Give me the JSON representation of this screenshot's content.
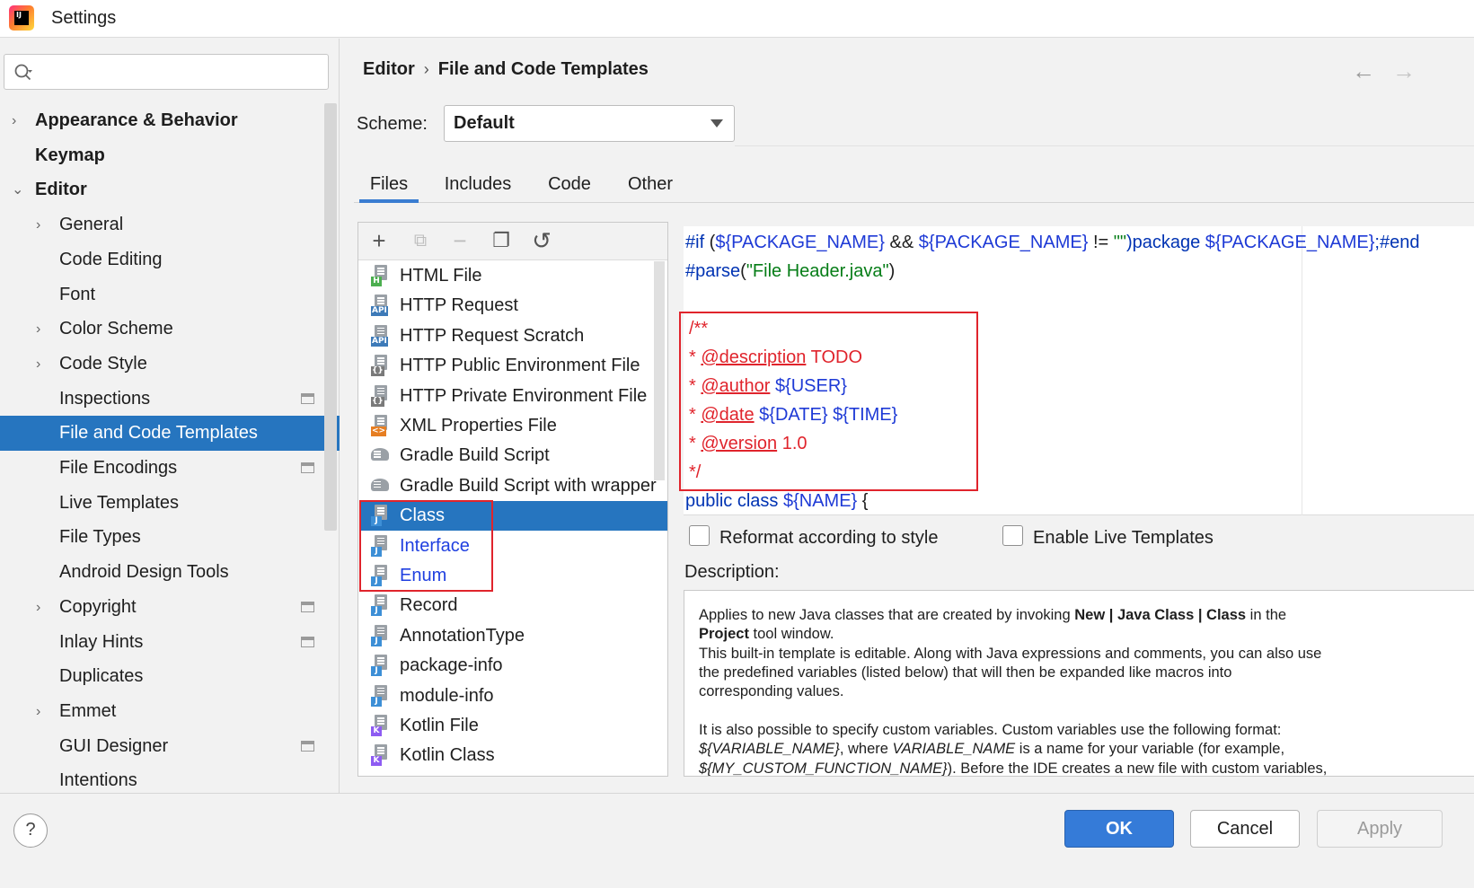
{
  "window": {
    "title": "Settings",
    "logo_text": "IJ"
  },
  "search": {
    "placeholder": ""
  },
  "sidebar": {
    "items": [
      {
        "label": "Appearance & Behavior",
        "arrow": "›",
        "bold": true
      },
      {
        "label": "Keymap",
        "arrow": "",
        "bold": true
      },
      {
        "label": "Editor",
        "arrow": "⌄",
        "bold": true
      },
      {
        "label": "General",
        "arrow": "›"
      },
      {
        "label": "Code Editing",
        "arrow": ""
      },
      {
        "label": "Font",
        "arrow": ""
      },
      {
        "label": "Color Scheme",
        "arrow": "›"
      },
      {
        "label": "Code Style",
        "arrow": "›"
      },
      {
        "label": "Inspections",
        "arrow": "",
        "project_icon": "project-settings-icon"
      },
      {
        "label": "File and Code Templates",
        "arrow": "",
        "selected": true
      },
      {
        "label": "File Encodings",
        "arrow": "",
        "project_icon": "project-settings-icon"
      },
      {
        "label": "Live Templates",
        "arrow": ""
      },
      {
        "label": "File Types",
        "arrow": ""
      },
      {
        "label": "Android Design Tools",
        "arrow": ""
      },
      {
        "label": "Copyright",
        "arrow": "›",
        "project_icon": "project-settings-icon"
      },
      {
        "label": "Inlay Hints",
        "arrow": "",
        "project_icon": "project-settings-icon"
      },
      {
        "label": "Duplicates",
        "arrow": ""
      },
      {
        "label": "Emmet",
        "arrow": "›"
      },
      {
        "label": "GUI Designer",
        "arrow": "",
        "project_icon": "project-settings-icon"
      },
      {
        "label": "Intentions",
        "arrow": ""
      }
    ]
  },
  "breadcrumb": {
    "parent": "Editor",
    "separator": "›",
    "current": "File and Code Templates"
  },
  "nav": {
    "back": "←",
    "forward": "→"
  },
  "scheme": {
    "label": "Scheme:",
    "value": "Default"
  },
  "tabs": [
    {
      "label": "Files",
      "active": true
    },
    {
      "label": "Includes"
    },
    {
      "label": "Code"
    },
    {
      "label": "Other"
    }
  ],
  "toolbar": {
    "add": "+",
    "copy_add": "⧉",
    "remove": "−",
    "duplicate": "❐",
    "reset": "↺"
  },
  "templates": [
    {
      "label": "HTML File",
      "badge": "H",
      "badge_color": "#4caf50"
    },
    {
      "label": "HTTP Request",
      "badge": "API",
      "badge_color": "#3d7ab8"
    },
    {
      "label": "HTTP Request Scratch",
      "badge": "API",
      "badge_color": "#3d7ab8"
    },
    {
      "label": "HTTP Public Environment File",
      "badge": "{}",
      "badge_color": "#7a7a7a"
    },
    {
      "label": "HTTP Private Environment File",
      "badge": "{}",
      "badge_color": "#7a7a7a"
    },
    {
      "label": "XML Properties File",
      "badge": "<>",
      "badge_color": "#e67e22"
    },
    {
      "label": "Gradle Build Script",
      "badge": "",
      "badge_color": "#8c9196",
      "icon": "gradle-elephant-icon"
    },
    {
      "label": "Gradle Build Script with wrapper",
      "badge": "",
      "badge_color": "#8c9196",
      "icon": "gradle-elephant-icon"
    },
    {
      "label": "Class",
      "badge": "J",
      "badge_color": "#3d8fd6",
      "selected": true
    },
    {
      "label": "Interface",
      "badge": "J",
      "badge_color": "#3d8fd6",
      "modified": true
    },
    {
      "label": "Enum",
      "badge": "J",
      "badge_color": "#3d8fd6",
      "modified": true
    },
    {
      "label": "Record",
      "badge": "J",
      "badge_color": "#3d8fd6"
    },
    {
      "label": "AnnotationType",
      "badge": "J",
      "badge_color": "#3d8fd6"
    },
    {
      "label": "package-info",
      "badge": "J",
      "badge_color": "#3d8fd6"
    },
    {
      "label": "module-info",
      "badge": "J",
      "badge_color": "#3d8fd6"
    },
    {
      "label": "Kotlin File",
      "badge": "K",
      "badge_color": "#8e5cf2"
    },
    {
      "label": "Kotlin Class",
      "badge": "K",
      "badge_color": "#8e5cf2"
    }
  ],
  "editor": {
    "line1_if": "#if",
    "line1_var1": "${PACKAGE_NAME}",
    "line1_and": "&&",
    "line1_var2": "${PACKAGE_NAME}",
    "line1_neq": "!=",
    "line1_str": "\"\"",
    "line1_pkg": ")package",
    "line1_var3": "${PACKAGE_NAME}",
    "line1_end": ";#end",
    "line2_parse": "#parse",
    "line2_str": "\"File Header.java\"",
    "comment_open": "/**",
    "desc_tag": "@description",
    "desc_val": "TODO",
    "author_tag": "@author",
    "author_val": "${USER}",
    "date_tag": "@date",
    "date_val1": "${DATE}",
    "date_val2": "${TIME}",
    "version_tag": "@version",
    "version_val": "1.0",
    "comment_close": "*/",
    "star": "*",
    "class_line_kw": "public class",
    "class_line_var": "${NAME}",
    "class_line_brace": "{"
  },
  "options": {
    "reformat_label": "Reformat according to style",
    "reformat_checked": false,
    "live_templates_label": "Enable Live Templates",
    "live_templates_checked": false
  },
  "description": {
    "label": "Description:",
    "l1a": "Applies to new Java classes that are created by invoking ",
    "l1b": "New | Java Class | Class",
    "l1c": " in the",
    "l2a": "Project",
    "l2b": " tool window.",
    "l3": "This built-in template is editable. Along with Java expressions and comments, you can also use",
    "l4": "the predefined variables (listed below) that will then be expanded like macros into",
    "l5": "corresponding values.",
    "l6": "It is also possible to specify custom variables. Custom variables use the following format:",
    "l7a": "${VARIABLE_NAME}",
    "l7b": ", where ",
    "l7c": "VARIABLE_NAME",
    "l7d": " is a name for your variable (for example,",
    "l8a": "${MY_CUSTOM_FUNCTION_NAME}",
    "l8b": "). Before the IDE creates a new file with custom variables,"
  },
  "buttons": {
    "help": "?",
    "ok": "OK",
    "cancel": "Cancel",
    "apply": "Apply"
  },
  "colors": {
    "selection": "#2675bf",
    "accent": "#357bd8",
    "highlight_box": "#e0242c",
    "modified_text": "#1f3fe0"
  }
}
